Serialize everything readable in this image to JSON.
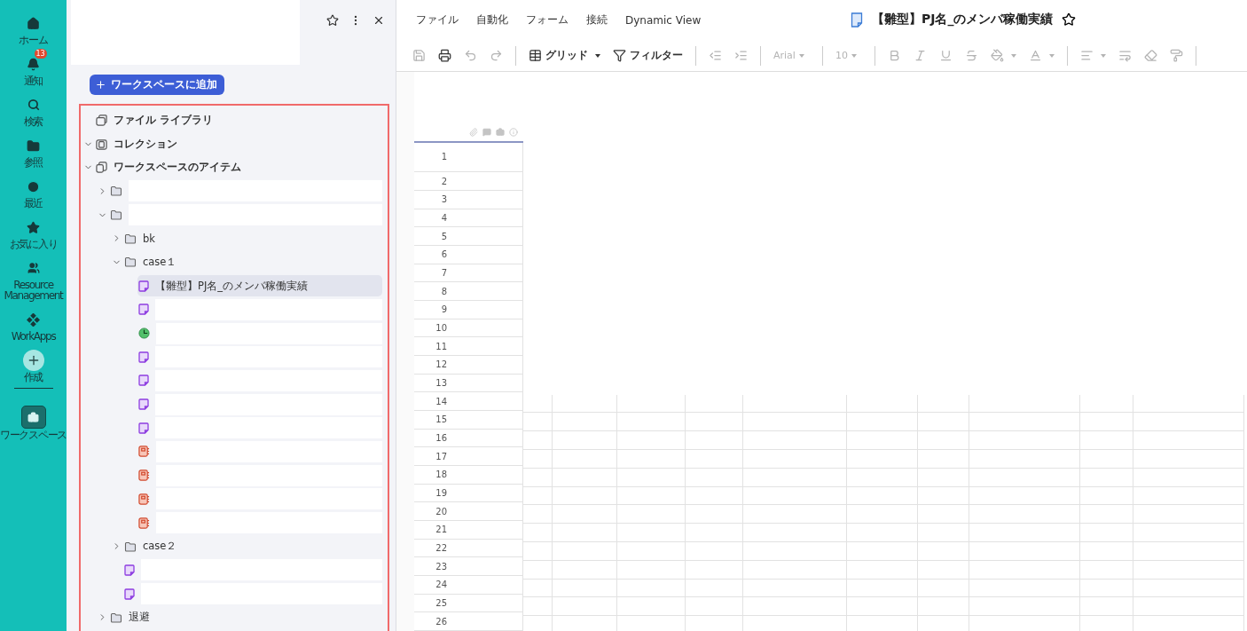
{
  "nav": {
    "items": [
      {
        "kind": "link",
        "label": "ホーム",
        "selected": false
      },
      {
        "kind": "link",
        "label": "通知",
        "badge": "13",
        "selected": false
      },
      {
        "kind": "link",
        "label": "検索",
        "selected": false
      },
      {
        "kind": "link",
        "label": "参照",
        "selected": false
      },
      {
        "kind": "link",
        "label": "最近",
        "selected": false
      },
      {
        "kind": "link",
        "label": "お気に入り",
        "selected": false
      },
      {
        "kind": "link",
        "label": "Resource Management",
        "selected": false
      },
      {
        "kind": "link",
        "label": "WorkApps",
        "selected": false
      },
      {
        "kind": "create",
        "label": "作成",
        "selected": false
      },
      {
        "kind": "divider"
      },
      {
        "kind": "link",
        "label": "ワークスペース",
        "selected": true
      }
    ]
  },
  "panel": {
    "add_button": "ワークスペースに追加",
    "tree": [
      {
        "kind": "library",
        "label": "ファイル ライブラリ",
        "selected": false
      },
      {
        "kind": "collection",
        "label": "コレクション",
        "expanded": true,
        "selected": false
      },
      {
        "kind": "workspace",
        "label": "ワークスペースのアイテム",
        "expanded": true,
        "selected": false,
        "children": [
          {
            "kind": "folder",
            "expanded": false,
            "selected": false
          },
          {
            "kind": "folder",
            "expanded": true,
            "selected": false,
            "children": [
              {
                "kind": "folder",
                "label": "bk",
                "expanded": false,
                "selected": false
              },
              {
                "kind": "folder",
                "label": "case１",
                "expanded": true,
                "selected": false,
                "children": [
                  {
                    "kind": "sheet",
                    "label": "【雛型】PJ名_のメンバ稼働実績",
                    "selected": true
                  },
                  {
                    "kind": "sheet",
                    "selected": false
                  },
                  {
                    "kind": "dashboard",
                    "selected": false
                  },
                  {
                    "kind": "sheet",
                    "selected": false
                  },
                  {
                    "kind": "sheet",
                    "selected": false
                  },
                  {
                    "kind": "sheet",
                    "selected": false
                  },
                  {
                    "kind": "sheet",
                    "selected": false
                  },
                  {
                    "kind": "report",
                    "selected": false
                  },
                  {
                    "kind": "report",
                    "selected": false
                  },
                  {
                    "kind": "report",
                    "selected": false
                  },
                  {
                    "kind": "report",
                    "selected": false
                  }
                ]
              },
              {
                "kind": "folder",
                "label": "case２",
                "expanded": false,
                "selected": false
              },
              {
                "kind": "sheet",
                "selected": false
              },
              {
                "kind": "sheet",
                "selected": false
              }
            ]
          },
          {
            "kind": "folder",
            "label": "退避",
            "expanded": false,
            "selected": false
          }
        ]
      }
    ]
  },
  "sheet": {
    "menu": [
      "ファイル",
      "自動化",
      "フォーム",
      "接続",
      "Dynamic View"
    ],
    "title": "【雛型】PJ名_のメンバ稼働実績",
    "toolbar": [
      {
        "kind": "icon",
        "disabled": true
      },
      {
        "kind": "icon",
        "disabled": false
      },
      {
        "kind": "icon",
        "disabled": true
      },
      {
        "kind": "icon",
        "disabled": true
      },
      {
        "kind": "separator"
      },
      {
        "kind": "menu",
        "label": "グリッド",
        "disabled": false
      },
      {
        "kind": "button",
        "label": "フィルター",
        "disabled": false
      },
      {
        "kind": "separator"
      },
      {
        "kind": "icon",
        "disabled": true
      },
      {
        "kind": "icon",
        "disabled": true
      },
      {
        "kind": "separator"
      },
      {
        "kind": "select",
        "value": "Arial",
        "disabled": true
      },
      {
        "kind": "separator"
      },
      {
        "kind": "select",
        "value": "10",
        "disabled": true
      },
      {
        "kind": "separator"
      },
      {
        "kind": "icon",
        "disabled": true
      },
      {
        "kind": "icon",
        "disabled": true
      },
      {
        "kind": "icon",
        "disabled": true
      },
      {
        "kind": "icon",
        "disabled": true
      },
      {
        "kind": "icon-menu",
        "disabled": true
      },
      {
        "kind": "icon-menu",
        "disabled": true
      },
      {
        "kind": "separator"
      },
      {
        "kind": "icon-menu",
        "disabled": true
      },
      {
        "kind": "icon",
        "disabled": true
      },
      {
        "kind": "icon",
        "disabled": true
      },
      {
        "kind": "icon",
        "disabled": true
      },
      {
        "kind": "separator"
      }
    ],
    "rows": [
      "1",
      "2",
      "3",
      "4",
      "5",
      "6",
      "7",
      "8",
      "9",
      "10",
      "11",
      "12",
      "13",
      "14",
      "15",
      "16",
      "17",
      "18",
      "19",
      "20",
      "21",
      "22",
      "23",
      "24",
      "25",
      "26"
    ]
  }
}
